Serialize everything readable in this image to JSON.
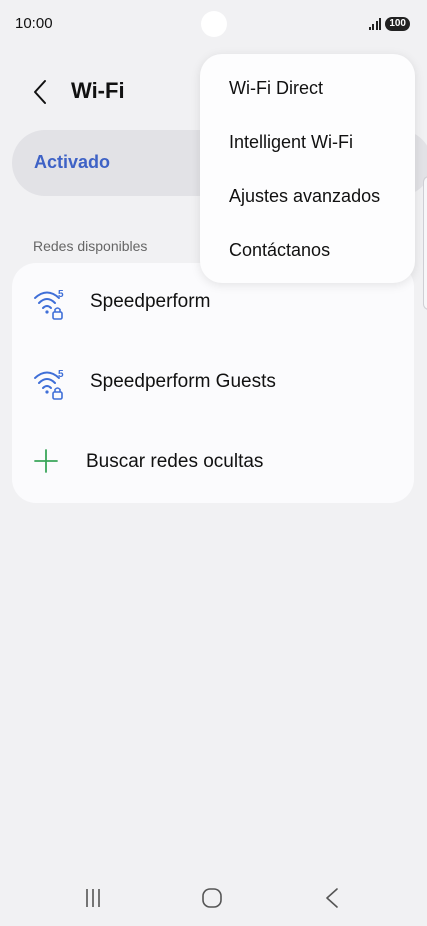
{
  "status_bar": {
    "time": "10:00",
    "battery": "100"
  },
  "header": {
    "title": "Wi-Fi",
    "back_icon": "chevron-left-icon"
  },
  "toggle": {
    "label": "Activado"
  },
  "networks_section": {
    "label": "Redes disponibles",
    "networks": [
      {
        "name": "Speedperform",
        "icon": "wifi-5ghz-locked-icon"
      },
      {
        "name": "Speedperform Guests",
        "icon": "wifi-5ghz-locked-icon"
      }
    ],
    "add_network": {
      "label": "Buscar redes ocultas",
      "icon": "plus-icon"
    }
  },
  "menu": {
    "items": [
      {
        "label": "Wi-Fi Direct"
      },
      {
        "label": "Intelligent Wi-Fi"
      },
      {
        "label": "Ajustes avanzados"
      },
      {
        "label": "Contáctanos"
      }
    ]
  },
  "nav_bar": {
    "recents_icon": "recents-icon",
    "home_icon": "home-icon",
    "back_icon": "back-icon"
  },
  "colors": {
    "background": "#f1f1f3",
    "accent": "#3e62c6",
    "wifi_icon": "#3f6fd8",
    "add_icon": "#3aa55a",
    "card": "#fbfbfd",
    "toggle_bg": "#e2e2e6"
  }
}
